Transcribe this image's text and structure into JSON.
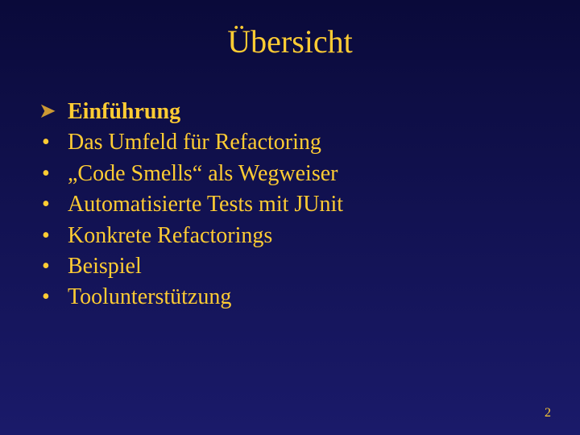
{
  "title": "Übersicht",
  "items": [
    {
      "bullet": "arrow",
      "text": "Einführung",
      "bold": true
    },
    {
      "bullet": "dot",
      "text": "Das Umfeld für Refactoring",
      "bold": false
    },
    {
      "bullet": "dot",
      "text": "„Code Smells“ als Wegweiser",
      "bold": false
    },
    {
      "bullet": "dot",
      "text": "Automatisierte Tests mit JUnit",
      "bold": false
    },
    {
      "bullet": "dot",
      "text": "Konkrete Refactorings",
      "bold": false
    },
    {
      "bullet": "dot",
      "text": "Beispiel",
      "bold": false
    },
    {
      "bullet": "dot",
      "text": "Toolunterstützung",
      "bold": false
    }
  ],
  "pageNumber": "2"
}
